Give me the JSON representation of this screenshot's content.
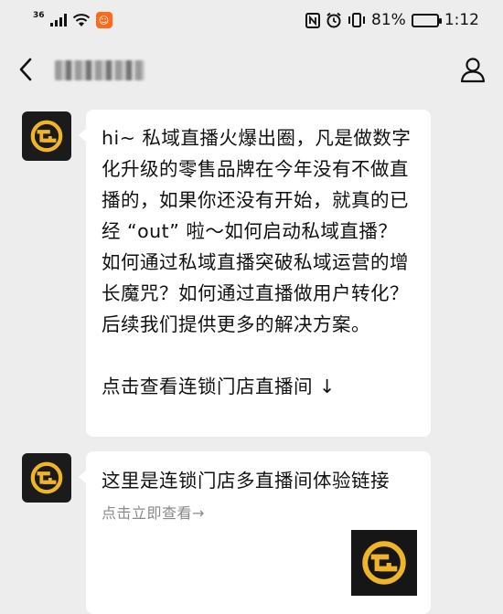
{
  "status_bar": {
    "network": "36",
    "battery": "81%",
    "battery_level": 0.81,
    "time": "1:12",
    "app_badge_icon": "smiley-app-icon"
  },
  "nav": {
    "back_icon": "chevron-left-icon",
    "profile_icon": "person-icon"
  },
  "messages": [
    {
      "text": "hi~ 私域直播火爆出圈，凡是做数字化升级的零售品牌在今年没有不做直播的，如果你还没有开始，就真的已经 “out” 啦～如何启动私域直播？如何通过私域直播突破私域运营的增长魔咒？如何通过直播做用户转化？后续我们提供更多的解决方案。",
      "link_text": "点击查看连锁门店直播间 ↓"
    },
    {
      "card_title": "这里是连锁门店多直播间体验链接",
      "card_desc": "点击立即查看→"
    }
  ],
  "colors": {
    "background": "#ededed",
    "bubble": "#ffffff",
    "avatar_bg": "#1b1b1b",
    "logo_gold": "#f0b429",
    "app_badge": "#ff6a1a"
  }
}
